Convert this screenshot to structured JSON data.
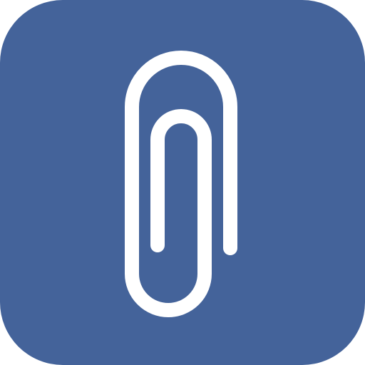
{
  "app_icon": {
    "icon": "paperclip-icon",
    "background_color": "#44639a",
    "glyph_color": "#ffffff"
  }
}
